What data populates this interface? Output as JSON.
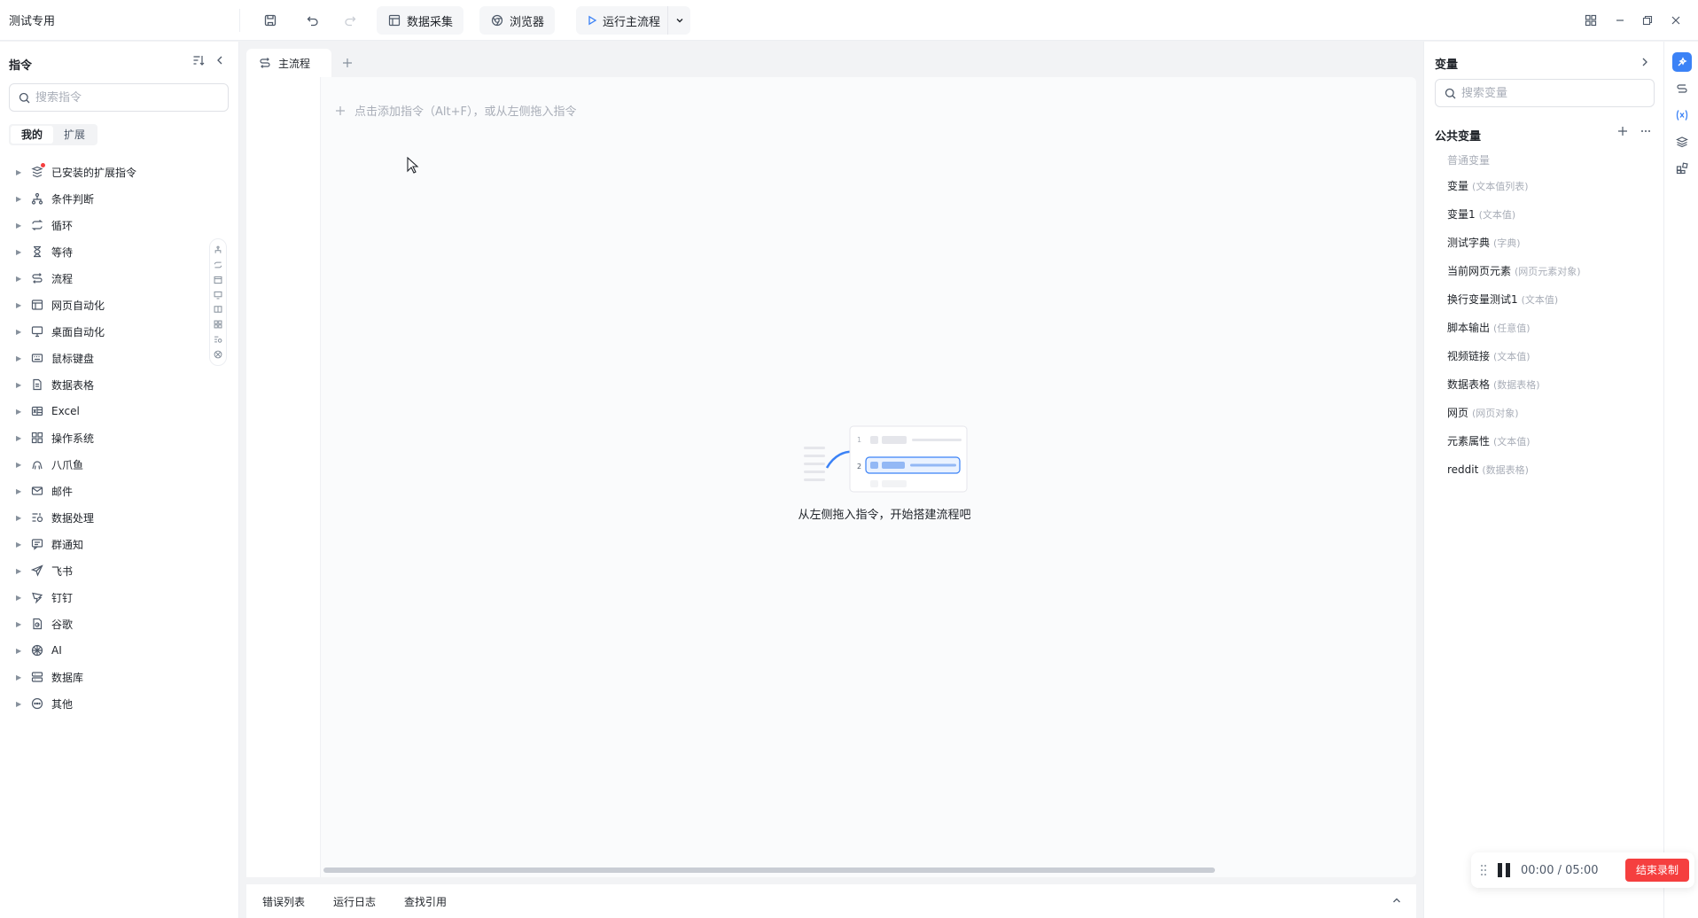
{
  "app": {
    "title": "测试专用"
  },
  "toolbar": {
    "data_capture": "数据采集",
    "browser": "浏览器",
    "run_main": "运行主流程"
  },
  "left": {
    "title": "指令",
    "search_placeholder": "搜索指令",
    "tabs": [
      "我的",
      "扩展"
    ],
    "commands": [
      {
        "label": "已安装的扩展指令",
        "icon": "extension-icon"
      },
      {
        "label": "条件判断",
        "icon": "branch-icon"
      },
      {
        "label": "循环",
        "icon": "loop-icon"
      },
      {
        "label": "等待",
        "icon": "hourglass-icon"
      },
      {
        "label": "流程",
        "icon": "flow-icon"
      },
      {
        "label": "网页自动化",
        "icon": "web-window-icon"
      },
      {
        "label": "桌面自动化",
        "icon": "monitor-icon"
      },
      {
        "label": "鼠标键盘",
        "icon": "keyboard-icon"
      },
      {
        "label": "数据表格",
        "icon": "document-icon"
      },
      {
        "label": "Excel",
        "icon": "excel-icon"
      },
      {
        "label": "操作系统",
        "icon": "grid-icon"
      },
      {
        "label": "八爪鱼",
        "icon": "octopus-icon"
      },
      {
        "label": "邮件",
        "icon": "mail-icon"
      },
      {
        "label": "数据处理",
        "icon": "data-process-icon"
      },
      {
        "label": "群通知",
        "icon": "chat-icon"
      },
      {
        "label": "飞书",
        "icon": "send-icon"
      },
      {
        "label": "钉钉",
        "icon": "dingtalk-icon"
      },
      {
        "label": "谷歌",
        "icon": "google-icon"
      },
      {
        "label": "AI",
        "icon": "ai-icon"
      },
      {
        "label": "数据库",
        "icon": "database-icon"
      },
      {
        "label": "其他",
        "icon": "more-circle-icon"
      }
    ]
  },
  "center": {
    "tab_main": "主流程",
    "add_hint": "点击添加指令（Alt+F），或从左侧拖入指令",
    "empty_text": "从左侧拖入指令，开始搭建流程吧",
    "empty_illustration_numbers": [
      "1",
      "2"
    ],
    "bottom_tabs": [
      "错误列表",
      "运行日志",
      "查找引用"
    ]
  },
  "right": {
    "title": "变量",
    "search_placeholder": "搜索变量",
    "section": "公共变量",
    "category": "普通变量",
    "variables": [
      {
        "name": "变量",
        "type": "(文本值列表)"
      },
      {
        "name": "变量1",
        "type": "(文本值)"
      },
      {
        "name": "测试字典",
        "type": "(字典)"
      },
      {
        "name": "当前网页元素",
        "type": "(网页元素对象)"
      },
      {
        "name": "换行变量测试1",
        "type": "(文本值)"
      },
      {
        "name": "脚本输出",
        "type": "(任意值)"
      },
      {
        "name": "视频链接",
        "type": "(文本值)"
      },
      {
        "name": "数据表格",
        "type": "(数据表格)"
      },
      {
        "name": "网页",
        "type": "(网页对象)"
      },
      {
        "name": "元素属性",
        "type": "(文本值)"
      },
      {
        "name": "reddit",
        "type": "(数据表格)"
      }
    ]
  },
  "recorder": {
    "time": "00:00 / 05:00",
    "stop_label": "结束录制"
  },
  "colors": {
    "accent": "#3b82f6",
    "danger": "#f53f3f"
  }
}
